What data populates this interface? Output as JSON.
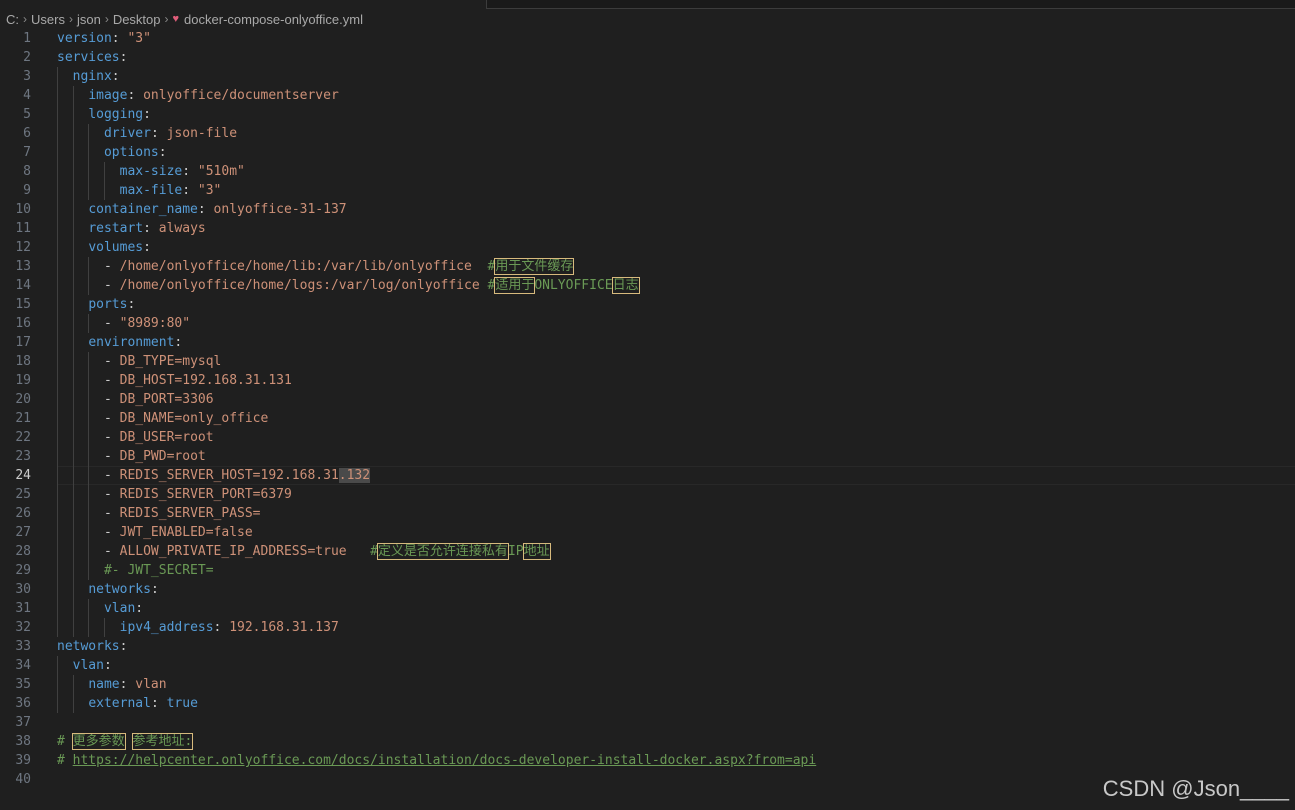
{
  "breadcrumb": {
    "drive": "C:",
    "items": [
      "Users",
      "json",
      "Desktop"
    ],
    "file": "docker-compose-onlyoffice.yml"
  },
  "editor": {
    "active_line": 24,
    "lines": [
      {
        "n": "1",
        "t": [
          [
            "k",
            "version"
          ],
          [
            "p",
            ": "
          ],
          [
            "s",
            "\"3\""
          ]
        ]
      },
      {
        "n": "2",
        "t": [
          [
            "k",
            "services"
          ],
          [
            "p",
            ":"
          ]
        ]
      },
      {
        "n": "3",
        "t": [
          [
            "p",
            "  "
          ],
          [
            "k",
            "nginx"
          ],
          [
            "p",
            ":"
          ]
        ]
      },
      {
        "n": "4",
        "t": [
          [
            "p",
            "    "
          ],
          [
            "k",
            "image"
          ],
          [
            "p",
            ": "
          ],
          [
            "v",
            "onlyoffice/documentserver"
          ]
        ]
      },
      {
        "n": "5",
        "t": [
          [
            "p",
            "    "
          ],
          [
            "k",
            "logging"
          ],
          [
            "p",
            ":"
          ]
        ]
      },
      {
        "n": "6",
        "t": [
          [
            "p",
            "      "
          ],
          [
            "k",
            "driver"
          ],
          [
            "p",
            ": "
          ],
          [
            "v",
            "json-file"
          ]
        ]
      },
      {
        "n": "7",
        "t": [
          [
            "p",
            "      "
          ],
          [
            "k",
            "options"
          ],
          [
            "p",
            ":"
          ]
        ]
      },
      {
        "n": "8",
        "t": [
          [
            "p",
            "        "
          ],
          [
            "k",
            "max-size"
          ],
          [
            "p",
            ": "
          ],
          [
            "s",
            "\"510m\""
          ]
        ]
      },
      {
        "n": "9",
        "t": [
          [
            "p",
            "        "
          ],
          [
            "k",
            "max-file"
          ],
          [
            "p",
            ": "
          ],
          [
            "s",
            "\"3\""
          ]
        ]
      },
      {
        "n": "10",
        "t": [
          [
            "p",
            "    "
          ],
          [
            "k",
            "container_name"
          ],
          [
            "p",
            ": "
          ],
          [
            "v",
            "onlyoffice-31-137"
          ]
        ]
      },
      {
        "n": "11",
        "t": [
          [
            "p",
            "    "
          ],
          [
            "k",
            "restart"
          ],
          [
            "p",
            ": "
          ],
          [
            "v",
            "always"
          ]
        ]
      },
      {
        "n": "12",
        "t": [
          [
            "p",
            "    "
          ],
          [
            "k",
            "volumes"
          ],
          [
            "p",
            ":"
          ]
        ]
      },
      {
        "n": "13",
        "t": [
          [
            "p",
            "      - "
          ],
          [
            "v",
            "/home/onlyoffice/home/lib:/var/lib/onlyoffice"
          ],
          [
            "p",
            "  "
          ],
          [
            "c",
            "#"
          ],
          [
            "cjk",
            "用于文件缓存"
          ]
        ]
      },
      {
        "n": "14",
        "t": [
          [
            "p",
            "      - "
          ],
          [
            "v",
            "/home/onlyoffice/home/logs:/var/log/onlyoffice"
          ],
          [
            "p",
            " "
          ],
          [
            "c",
            "#"
          ],
          [
            "cjk",
            "适用于"
          ],
          [
            "c",
            "ONLYOFFICE"
          ],
          [
            "cjk",
            "日志"
          ]
        ]
      },
      {
        "n": "15",
        "t": [
          [
            "p",
            "    "
          ],
          [
            "k",
            "ports"
          ],
          [
            "p",
            ":"
          ]
        ]
      },
      {
        "n": "16",
        "t": [
          [
            "p",
            "      - "
          ],
          [
            "s",
            "\"8989:80\""
          ]
        ]
      },
      {
        "n": "17",
        "t": [
          [
            "p",
            "    "
          ],
          [
            "k",
            "environment"
          ],
          [
            "p",
            ":"
          ]
        ]
      },
      {
        "n": "18",
        "t": [
          [
            "p",
            "      - "
          ],
          [
            "v",
            "DB_TYPE=mysql"
          ]
        ]
      },
      {
        "n": "19",
        "t": [
          [
            "p",
            "      - "
          ],
          [
            "v",
            "DB_HOST=192.168.31.131"
          ]
        ]
      },
      {
        "n": "20",
        "t": [
          [
            "p",
            "      - "
          ],
          [
            "v",
            "DB_PORT=3306"
          ]
        ]
      },
      {
        "n": "21",
        "t": [
          [
            "p",
            "      - "
          ],
          [
            "v",
            "DB_NAME=only_office"
          ]
        ]
      },
      {
        "n": "22",
        "t": [
          [
            "p",
            "      - "
          ],
          [
            "v",
            "DB_USER=root"
          ]
        ]
      },
      {
        "n": "23",
        "t": [
          [
            "p",
            "      - "
          ],
          [
            "v",
            "DB_PWD=root"
          ]
        ]
      },
      {
        "n": "24",
        "t": [
          [
            "p",
            "      - "
          ],
          [
            "v",
            "REDIS_SERVER_HOST=192.168.31"
          ],
          [
            "sel",
            ".132"
          ]
        ]
      },
      {
        "n": "25",
        "t": [
          [
            "p",
            "      - "
          ],
          [
            "v",
            "REDIS_SERVER_PORT=6379"
          ]
        ]
      },
      {
        "n": "26",
        "t": [
          [
            "p",
            "      - "
          ],
          [
            "v",
            "REDIS_SERVER_PASS="
          ]
        ]
      },
      {
        "n": "27",
        "t": [
          [
            "p",
            "      - "
          ],
          [
            "v",
            "JWT_ENABLED=false"
          ]
        ]
      },
      {
        "n": "28",
        "t": [
          [
            "p",
            "      - "
          ],
          [
            "v",
            "ALLOW_PRIVATE_IP_ADDRESS=true"
          ],
          [
            "p",
            "   "
          ],
          [
            "c",
            "#"
          ],
          [
            "cjk",
            "定义是否允许连接私有"
          ],
          [
            "c",
            "IP"
          ],
          [
            "cjk",
            "地址"
          ]
        ]
      },
      {
        "n": "29",
        "t": [
          [
            "p",
            "      "
          ],
          [
            "c",
            "#- JWT_SECRET="
          ]
        ]
      },
      {
        "n": "30",
        "t": [
          [
            "p",
            "    "
          ],
          [
            "k",
            "networks"
          ],
          [
            "p",
            ":"
          ]
        ]
      },
      {
        "n": "31",
        "t": [
          [
            "p",
            "      "
          ],
          [
            "k",
            "vlan"
          ],
          [
            "p",
            ":"
          ]
        ]
      },
      {
        "n": "32",
        "t": [
          [
            "p",
            "        "
          ],
          [
            "k",
            "ipv4_address"
          ],
          [
            "p",
            ": "
          ],
          [
            "v",
            "192.168.31.137"
          ]
        ]
      },
      {
        "n": "33",
        "t": [
          [
            "k",
            "networks"
          ],
          [
            "p",
            ":"
          ]
        ]
      },
      {
        "n": "34",
        "t": [
          [
            "p",
            "  "
          ],
          [
            "k",
            "vlan"
          ],
          [
            "p",
            ":"
          ]
        ]
      },
      {
        "n": "35",
        "t": [
          [
            "p",
            "    "
          ],
          [
            "k",
            "name"
          ],
          [
            "p",
            ": "
          ],
          [
            "v",
            "vlan"
          ]
        ]
      },
      {
        "n": "36",
        "t": [
          [
            "p",
            "    "
          ],
          [
            "k",
            "external"
          ],
          [
            "p",
            ": "
          ],
          [
            "b",
            "true"
          ]
        ]
      },
      {
        "n": "37",
        "t": []
      },
      {
        "n": "38",
        "t": [
          [
            "c",
            "# "
          ],
          [
            "cjk",
            "更多参数"
          ],
          [
            "c",
            " "
          ],
          [
            "cjk",
            "参考地址:"
          ]
        ]
      },
      {
        "n": "39",
        "t": [
          [
            "c",
            "# "
          ],
          [
            "link",
            "https://helpcenter.onlyoffice.com/docs/installation/docs-developer-install-docker.aspx?from=api"
          ]
        ]
      },
      {
        "n": "40",
        "t": []
      }
    ]
  },
  "watermark": "CSDN @Json____"
}
